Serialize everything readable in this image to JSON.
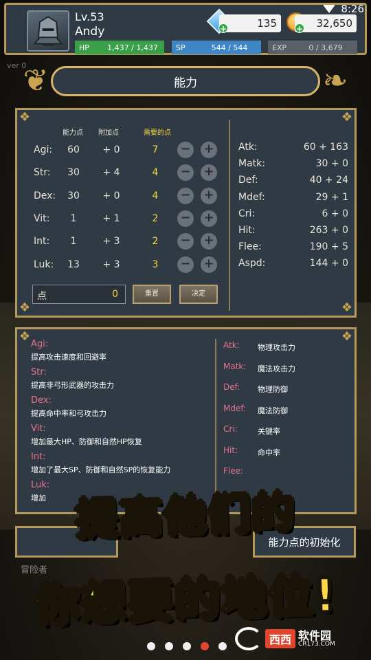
{
  "status_bar": {
    "time": "8:26"
  },
  "player": {
    "level": "Lv.53",
    "name": "Andy"
  },
  "bars": {
    "hp_label": "HP",
    "hp_value": "1,437 / 1,437",
    "sp_label": "SP",
    "sp_value": "544 / 544",
    "exp_label": "EXP",
    "exp_value": "0 / 3,679"
  },
  "currency": {
    "gems": "135",
    "coins": "32,650"
  },
  "version": "ver 0",
  "title": "能力",
  "stats_table": {
    "headers": {
      "points": "能力点",
      "bonus": "附加点",
      "need": "需要的点"
    },
    "rows": [
      {
        "label": "Agi:",
        "points": "60",
        "bonus": "+ 0",
        "need": "7"
      },
      {
        "label": "Str:",
        "points": "30",
        "bonus": "+ 4",
        "need": "4"
      },
      {
        "label": "Dex:",
        "points": "30",
        "bonus": "+ 0",
        "need": "4"
      },
      {
        "label": "Vit:",
        "points": "1",
        "bonus": "+ 1",
        "need": "2"
      },
      {
        "label": "Int:",
        "points": "1",
        "bonus": "+ 3",
        "need": "2"
      },
      {
        "label": "Luk:",
        "points": "13",
        "bonus": "+ 3",
        "need": "3"
      }
    ],
    "minus_symbol": "−",
    "plus_symbol": "+",
    "points_label": "点",
    "points_value": "0",
    "reset_label": "重置",
    "confirm_label": "决定"
  },
  "derived": [
    {
      "key": "Atk:",
      "value": "60 + 163"
    },
    {
      "key": "Matk:",
      "value": "30 + 0"
    },
    {
      "key": "Def:",
      "value": "40 + 24"
    },
    {
      "key": "Mdef:",
      "value": "29 + 1"
    },
    {
      "key": "Cri:",
      "value": "6 + 0"
    },
    {
      "key": "Hit:",
      "value": "263 + 0"
    },
    {
      "key": "Flee:",
      "value": "190 + 5"
    },
    {
      "key": "Aspd:",
      "value": "144 + 0"
    }
  ],
  "descriptions": [
    {
      "title": "Agi:",
      "text": "提高攻击速度和回避率"
    },
    {
      "title": "Str:",
      "text": "提高非弓形武器的攻击力"
    },
    {
      "title": "Dex:",
      "text": "提高命中率和弓攻击力"
    },
    {
      "title": "Vit:",
      "text": "增加最大HP、防御和自然HP恢复"
    },
    {
      "title": "Int:",
      "text": "增加了最大SP、防御和自然SP的恢复能力"
    },
    {
      "title": "Luk:",
      "text": "增加"
    }
  ],
  "glossary": [
    {
      "key": "Atk:",
      "value": "物理攻击力"
    },
    {
      "key": "Matk:",
      "value": "魔法攻击力"
    },
    {
      "key": "Def:",
      "value": "物理防御"
    },
    {
      "key": "Mdef:",
      "value": "魔法防御"
    },
    {
      "key": "Cri:",
      "value": "关键率"
    },
    {
      "key": "Hit:",
      "value": "命中率"
    },
    {
      "key": "Flee:",
      "value": ""
    }
  ],
  "bottom": {
    "reset_points_label": "能力点的初始化",
    "adventurer_label": "冒险者"
  },
  "promo": {
    "line1": "提高他们的",
    "line2": "你想要的地位!"
  },
  "pager": {
    "count": 5,
    "active_index": 3
  },
  "watermark": {
    "brand": "西西",
    "name": "软件园",
    "url": "CR173.COM"
  }
}
